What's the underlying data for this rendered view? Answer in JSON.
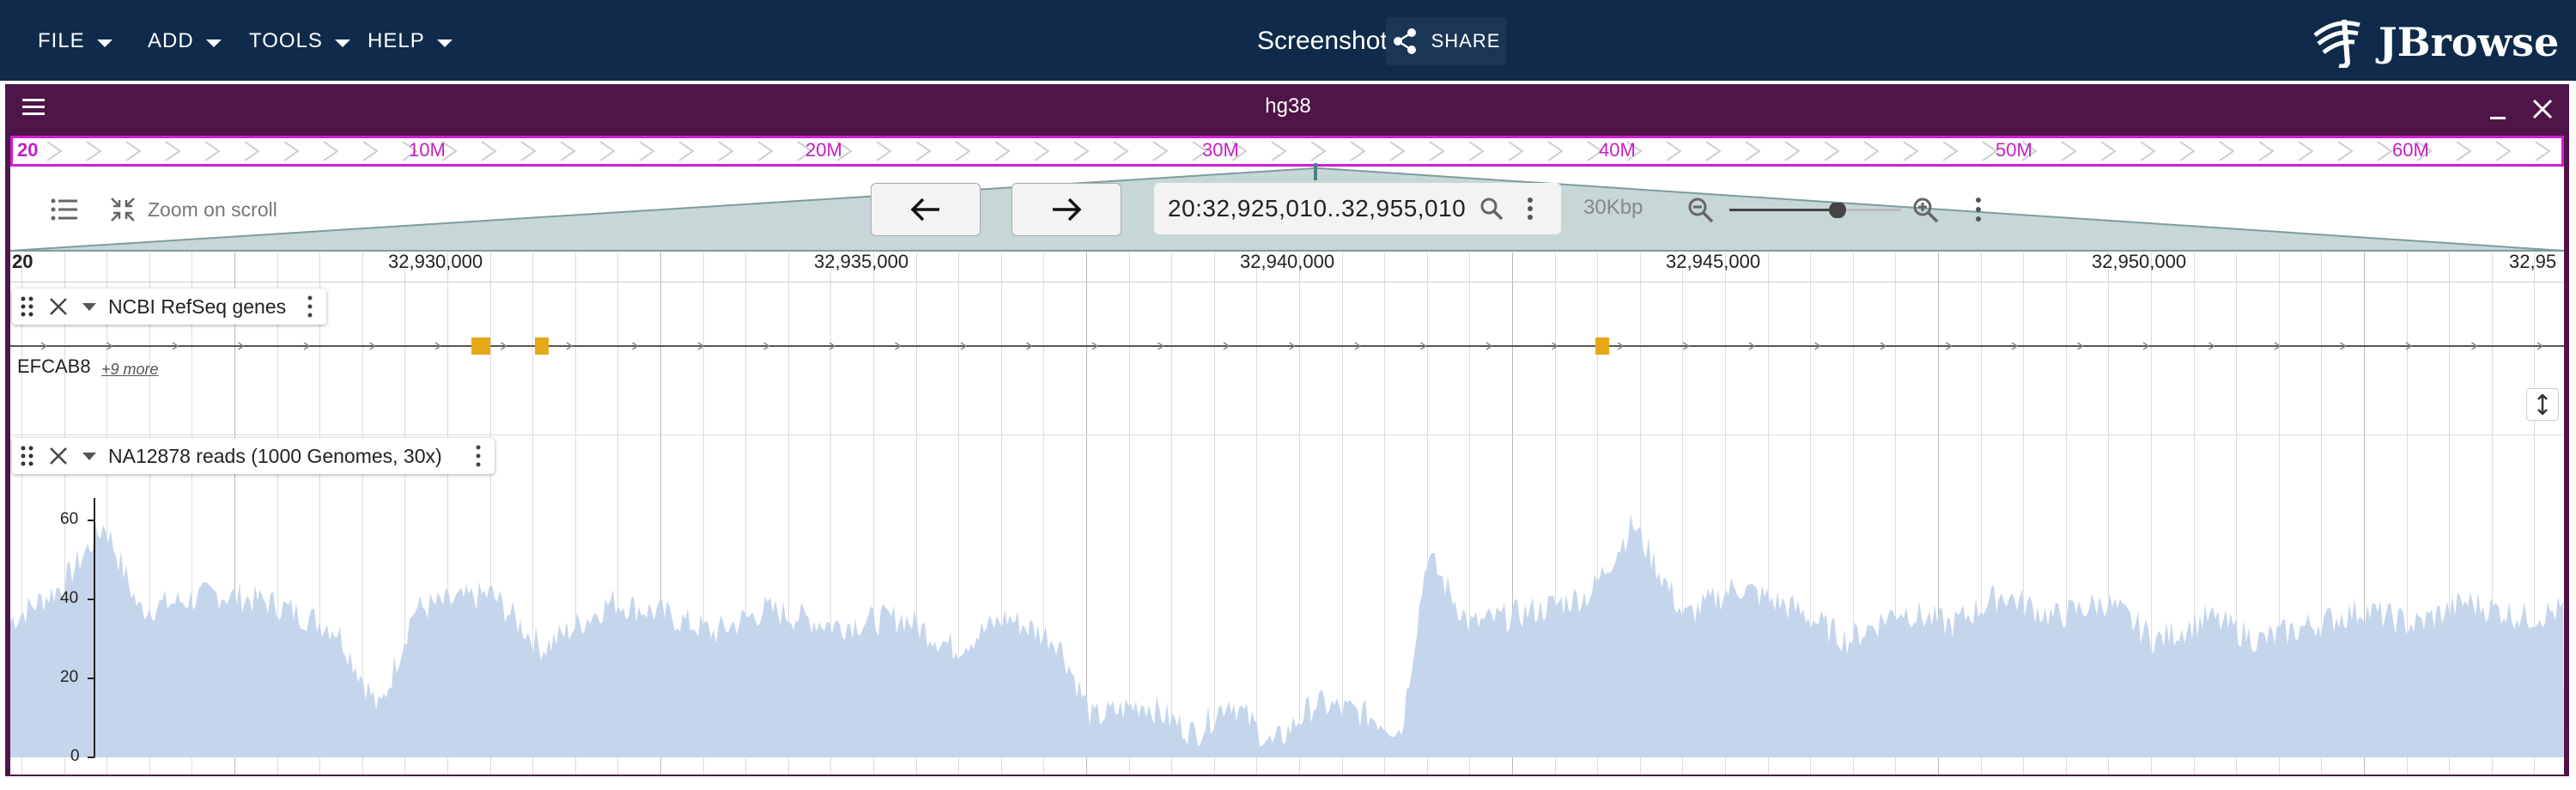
{
  "menu": {
    "items": [
      {
        "label": "FILE"
      },
      {
        "label": "ADD"
      },
      {
        "label": "TOOLS"
      },
      {
        "label": "HELP"
      }
    ]
  },
  "header": {
    "title": "Screenshot",
    "share_label": "SHARE",
    "logo_text": "JBrowse"
  },
  "view": {
    "assembly": "hg38",
    "overview": {
      "chrom_label": "20",
      "labels": [
        "10M",
        "20M",
        "30M",
        "40M",
        "50M",
        "60M"
      ]
    },
    "controls": {
      "zoom_on_scroll": "Zoom on scroll",
      "location": "20:32,925,010..32,955,010",
      "span": "30Kbp",
      "zoom_level": 0.63
    },
    "ruler": {
      "chrom": "20",
      "labels": [
        "32,930,000",
        "32,935,000",
        "32,940,000",
        "32,945,000",
        "32,950,000",
        "32,95"
      ]
    },
    "tracks": [
      {
        "name": "NCBI RefSeq genes",
        "gene_label": "EFCAB8",
        "more_label": "+9 more"
      },
      {
        "name": "NA12878 reads (1000 Genomes, 30x)",
        "y_ticks": [
          "60",
          "40",
          "20",
          "0"
        ]
      }
    ]
  },
  "colors": {
    "appbar": "#0f2a4a",
    "view_frame": "#4f1548",
    "overview_highlight": "#d21ed2",
    "coverage_fill": "#c5d5ec",
    "exon": "#e6a817"
  }
}
